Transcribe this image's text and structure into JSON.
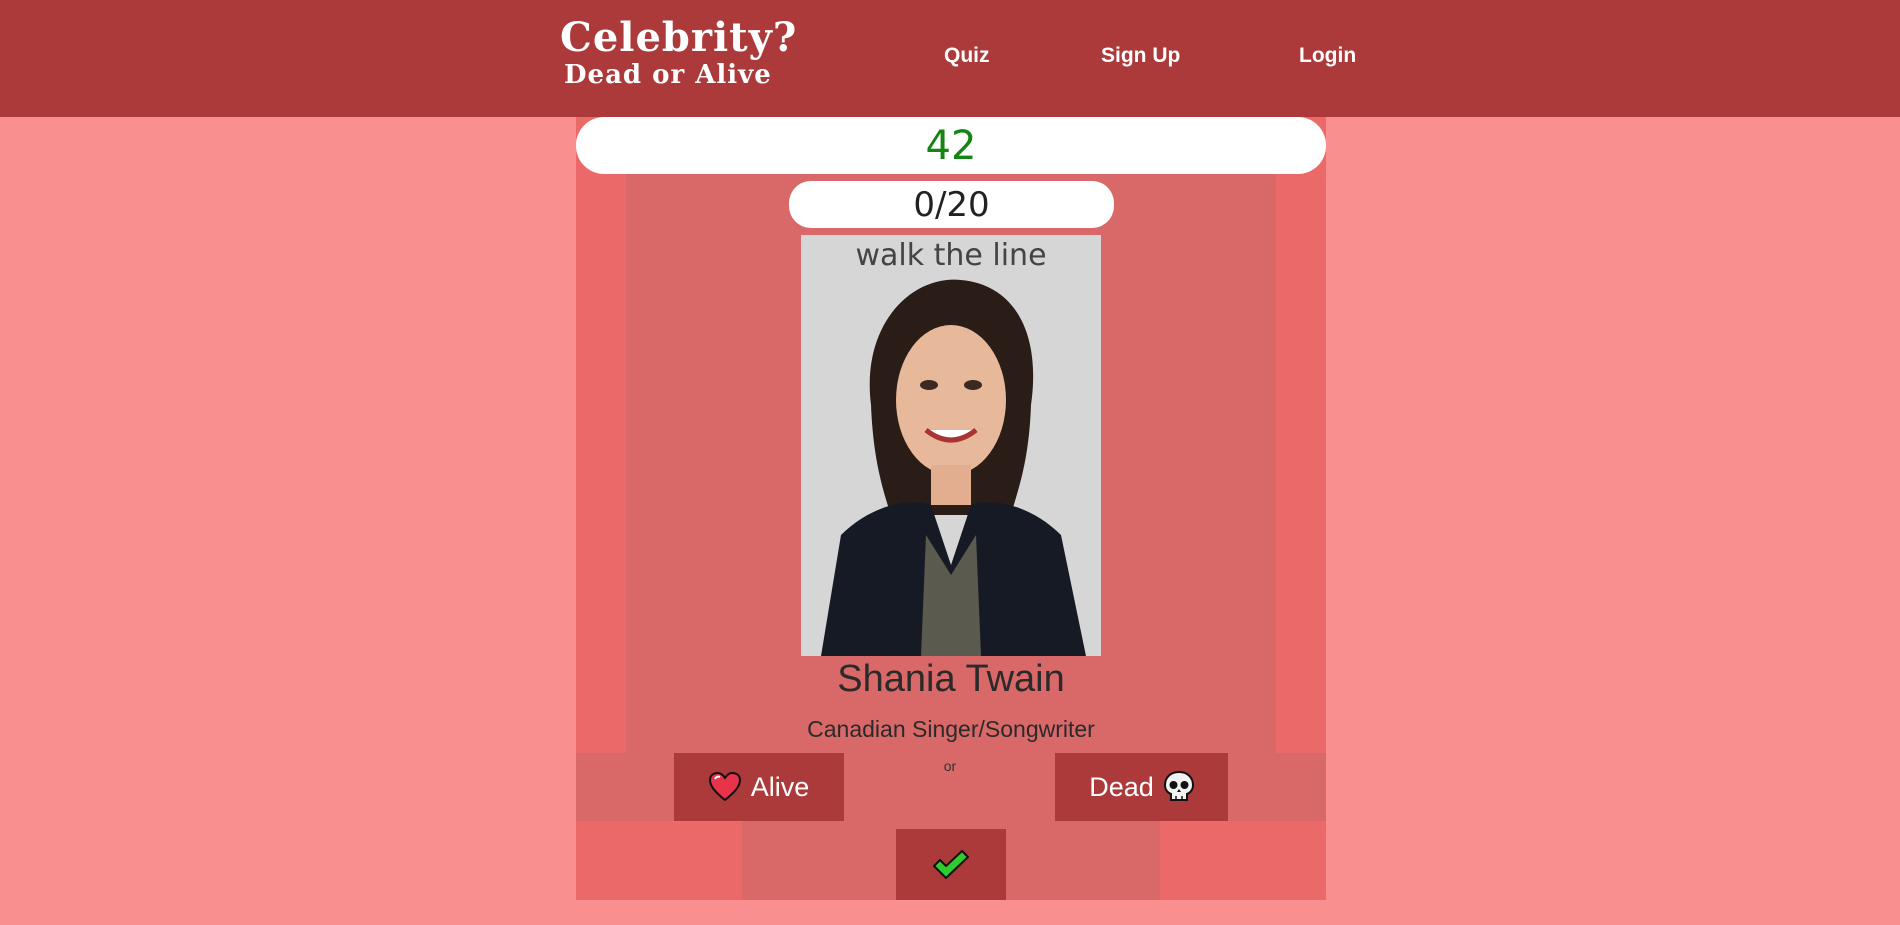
{
  "header": {
    "logo_title": "Celebrity?",
    "logo_subtitle": "Dead or Alive",
    "nav": [
      {
        "label": "Quiz"
      },
      {
        "label": "Sign Up"
      },
      {
        "label": "Login"
      }
    ]
  },
  "quiz": {
    "timer": "42",
    "score": "0/20",
    "celebrity": {
      "name": "Shania Twain",
      "description": "Canadian Singer/Songwriter",
      "photo_backdrop_text": "walk the line"
    },
    "alive_label": "Alive",
    "dead_label": "Dead",
    "or_label": "or",
    "icons": {
      "alive": "heart-icon",
      "dead": "skull-icon",
      "submit": "checkmark-icon"
    }
  },
  "colors": {
    "header_bg": "#ad3a3a",
    "page_bg": "#fa8f8f",
    "timer_text": "#148514",
    "button_bg": "#ad3a3a"
  }
}
